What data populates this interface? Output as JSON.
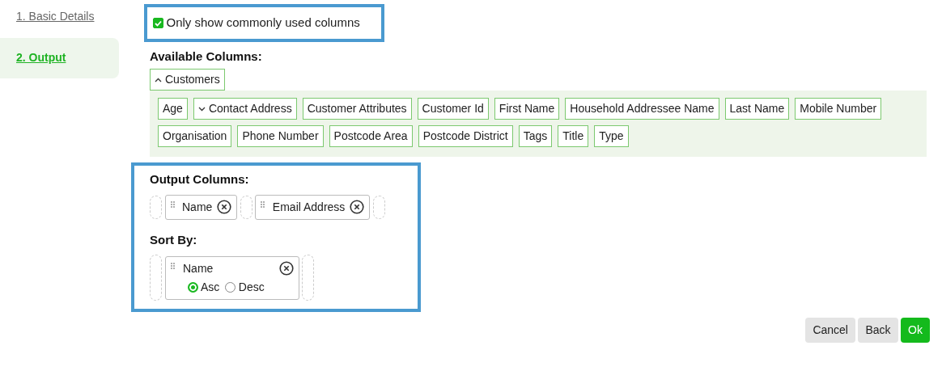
{
  "steps": [
    {
      "label": "1. Basic Details",
      "selected": false
    },
    {
      "label": "2. Output",
      "selected": true
    }
  ],
  "common_only": {
    "label": "Only show commonly used columns",
    "checked": true
  },
  "available": {
    "heading": "Available Columns:",
    "group": {
      "label": "Customers",
      "expanded": true
    },
    "columns": [
      {
        "label": "Age",
        "kind": "field"
      },
      {
        "label": "Contact Address",
        "kind": "group",
        "expanded": false
      },
      {
        "label": "Customer Attributes",
        "kind": "field"
      },
      {
        "label": "Customer Id",
        "kind": "field"
      },
      {
        "label": "First Name",
        "kind": "field"
      },
      {
        "label": "Household Addressee Name",
        "kind": "field"
      },
      {
        "label": "Last Name",
        "kind": "field"
      },
      {
        "label": "Mobile Number",
        "kind": "field"
      },
      {
        "label": "Organisation",
        "kind": "field"
      },
      {
        "label": "Phone Number",
        "kind": "field"
      },
      {
        "label": "Postcode Area",
        "kind": "field"
      },
      {
        "label": "Postcode District",
        "kind": "field"
      },
      {
        "label": "Tags",
        "kind": "field"
      },
      {
        "label": "Title",
        "kind": "field"
      },
      {
        "label": "Type",
        "kind": "field"
      }
    ]
  },
  "output": {
    "heading": "Output Columns:",
    "columns": [
      {
        "label": "Name"
      },
      {
        "label": "Email Address"
      }
    ]
  },
  "sort": {
    "heading": "Sort By:",
    "items": [
      {
        "label": "Name",
        "options": [
          {
            "label": "Asc",
            "selected": true
          },
          {
            "label": "Desc",
            "selected": false
          }
        ]
      }
    ]
  },
  "buttons": [
    {
      "label": "Cancel",
      "kind": "secondary"
    },
    {
      "label": "Back",
      "kind": "secondary"
    },
    {
      "label": "Ok",
      "kind": "primary"
    }
  ]
}
